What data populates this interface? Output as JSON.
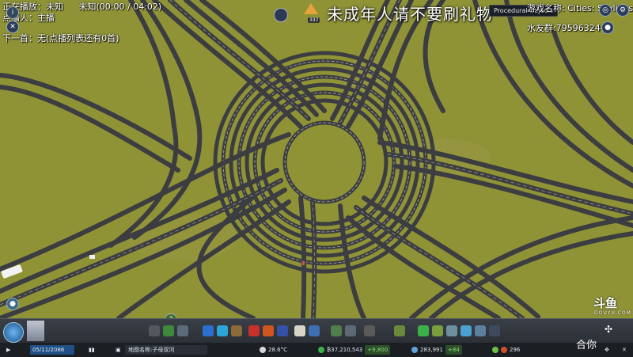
{
  "overlay": {
    "now_playing_label": "正在播放：",
    "now_playing_song": "未知",
    "now_playing_time": "未知(00:00 / 04:02)",
    "singer_label": "点播人：",
    "singer_value": "主播",
    "next_song": "下一首：无(点播列表还有0首)",
    "banner": "未成年人请不要刷礼物",
    "game_name": "游戏名称: Cities: Skylines",
    "fan_group": "水友群:795963244",
    "tooltip": "Procedural Objects",
    "badge_count": "337"
  },
  "toolbar": {
    "date": "05/11/2086",
    "map_name": "地图名称:子母双河",
    "temperature": "28.6°C",
    "funds": "₿37,210,543",
    "income": "+9,800",
    "population": "283,991",
    "population_delta": "+84",
    "unlock_count": "296"
  },
  "watermark": {
    "logo": "斗鱼",
    "sub": "DOUYU.COM",
    "streamer": "合你"
  },
  "colors": {
    "grass": "#8f9336",
    "road": "#3c3d41",
    "lane_marking": "#c9c9c2",
    "toolbar": "#2a2e35"
  }
}
